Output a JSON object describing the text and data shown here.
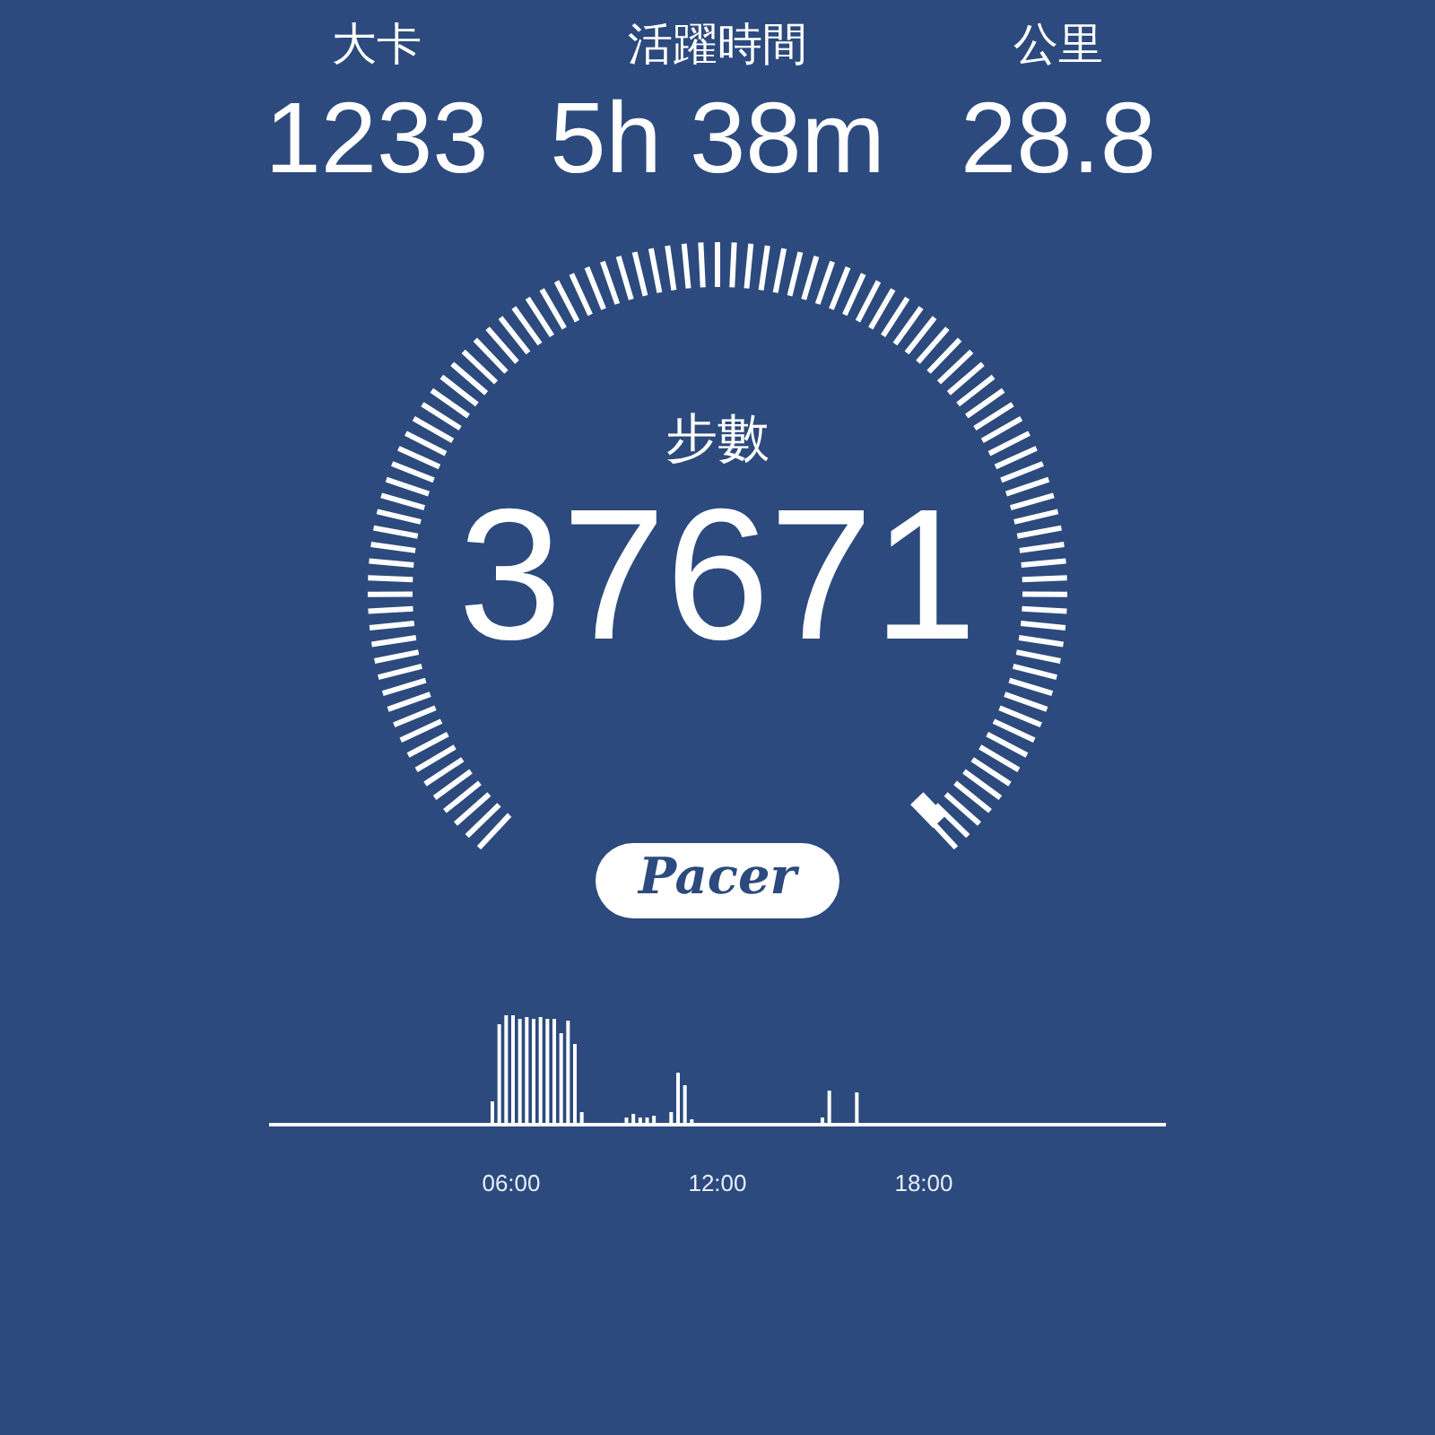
{
  "stats": [
    {
      "label": "大卡",
      "value": "1233"
    },
    {
      "label": "活躍時間",
      "value": "5h 38m"
    },
    {
      "label": "公里",
      "value": "28.8"
    }
  ],
  "gauge": {
    "label": "步數",
    "value": "37671"
  },
  "logo": {
    "text": "Pacer"
  },
  "activity_chart": {
    "x_labels": [
      "06:00",
      "12:00",
      "18:00"
    ]
  }
}
